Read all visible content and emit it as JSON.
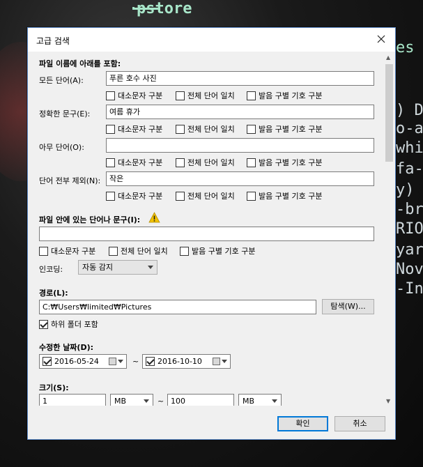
{
  "background": {
    "line1": "pstore",
    "right_lines": [
      "es",
      ") D",
      "o-a",
      "whi",
      "fa-",
      "y)",
      "-br",
      "RIO",
      "yar",
      "Nov",
      "-In"
    ]
  },
  "dialog": {
    "title": "고급 검색",
    "section_include": "파일 이름에 아래를 포함:",
    "all_words_label": "모든 단어(A):",
    "all_words_value": "푸른 호수 사진",
    "exact_phrase_label": "정확한 문구(E):",
    "exact_phrase_value": "여름 휴가",
    "any_words_label": "아무 단어(O):",
    "any_words_value": "",
    "exclude_label": "단어 전부 제외(N):",
    "exclude_value": "작은",
    "opt_case": "대소문자 구분",
    "opt_whole": "전체 단어 일치",
    "opt_diacritic": "발음 구별 기호 구분",
    "section_content": "파일 안에 있는 단어나 문구(I):",
    "content_value": "",
    "encoding_label": "인코딩:",
    "encoding_value": "자동 감지",
    "section_path": "경로(L):",
    "path_value": "C:₩Users₩limited₩Pictures",
    "browse_button": "탐색(W)...",
    "subfolder_label": "하위 폴더 포함",
    "section_date": "수정한 날짜(D):",
    "date_from": "2016-05-24",
    "date_to": "2016-10-10",
    "date_sep": "~",
    "section_size": "크기(S):",
    "size_from": "1",
    "size_from_unit": "MB",
    "size_to": "100",
    "size_to_unit": "MB",
    "size_sep": "~",
    "ok_button": "확인",
    "cancel_button": "취소"
  }
}
